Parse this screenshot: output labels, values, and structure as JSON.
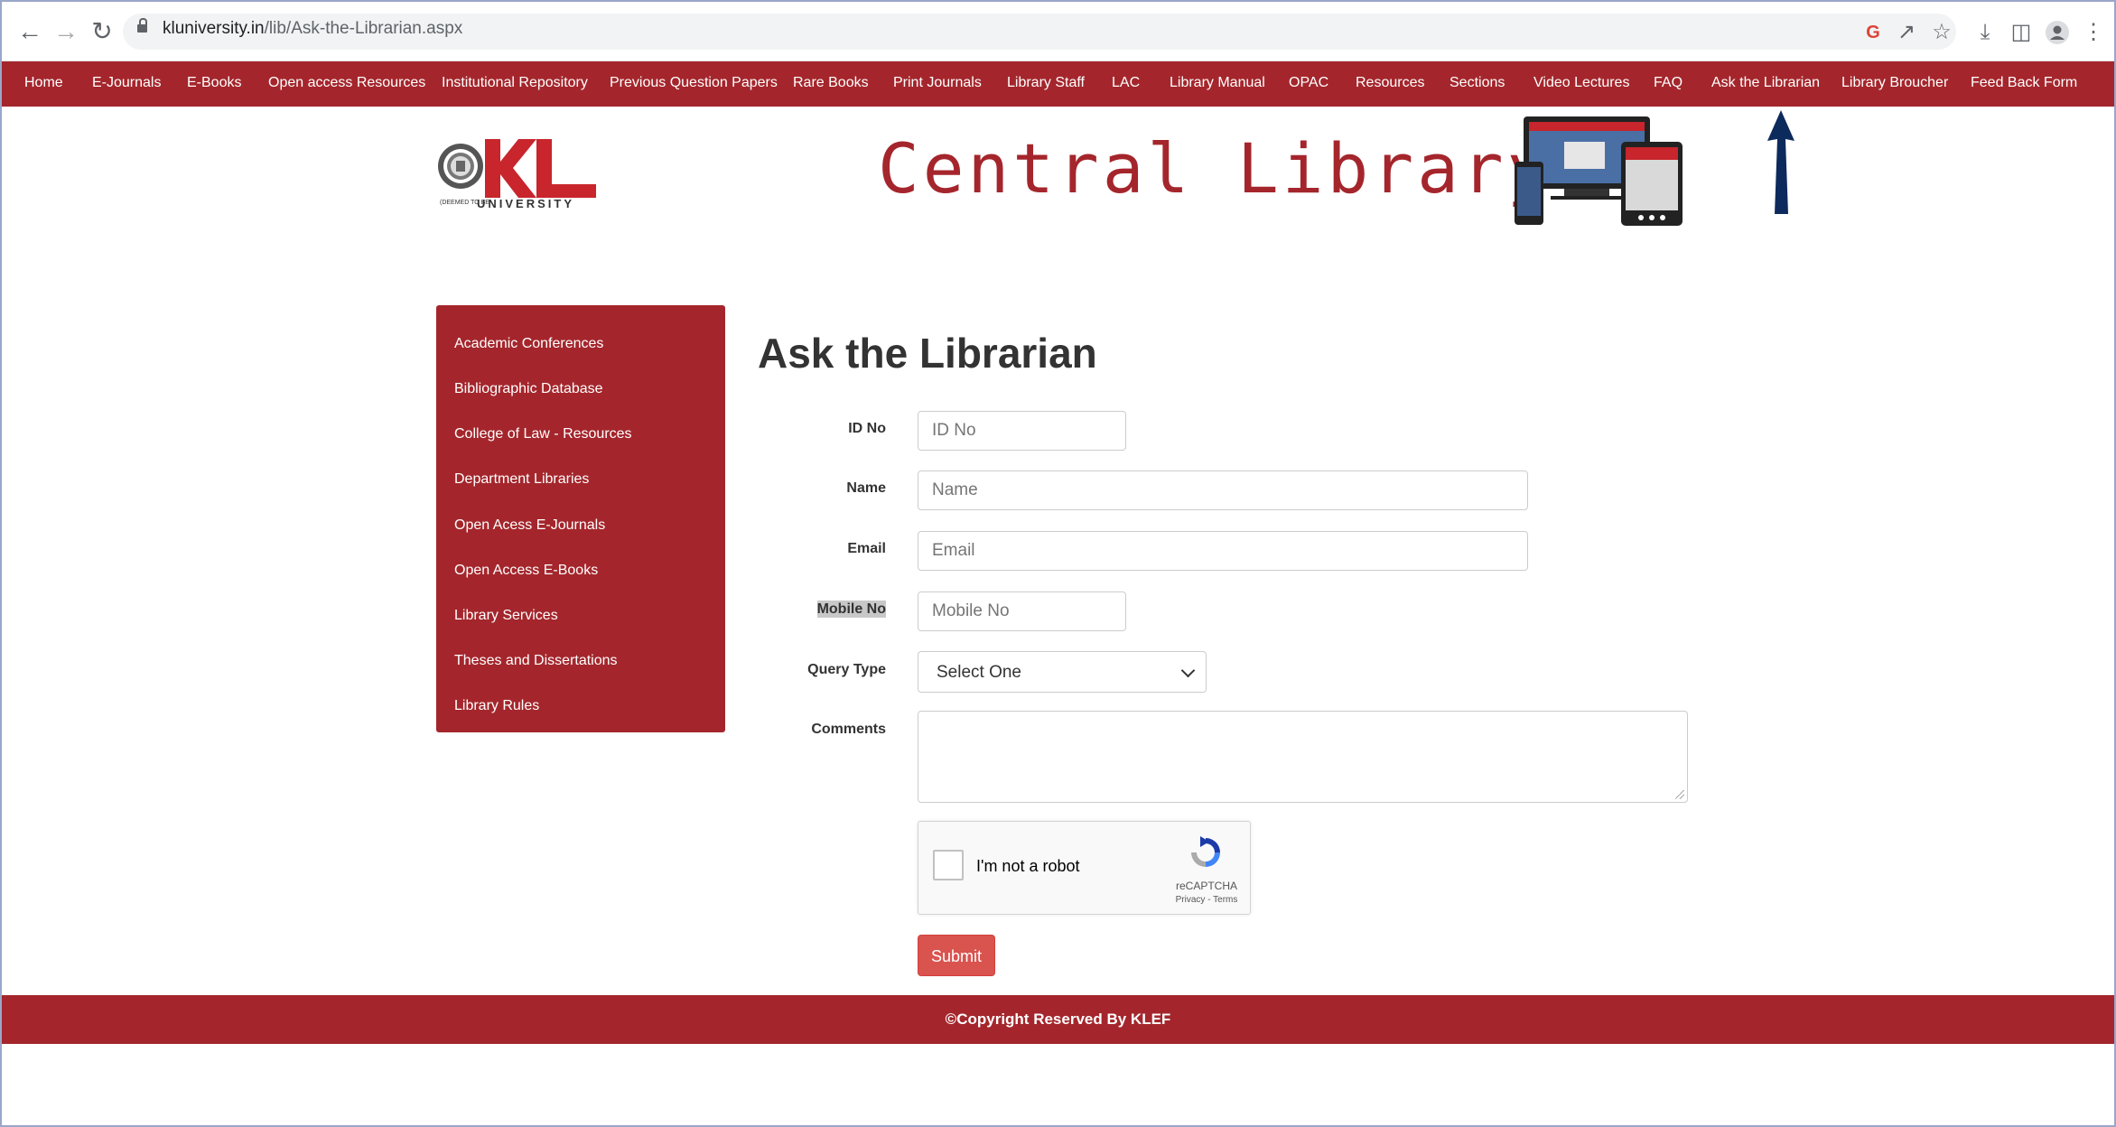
{
  "browser": {
    "url_domain": "kluniversity.in",
    "url_path": "/lib/Ask-the-Librarian.aspx"
  },
  "nav": {
    "items": [
      "Home",
      "E-Journals",
      "E-Books",
      "Open access Resources",
      "Institutional Repository",
      "Previous Question Papers",
      "Rare Books",
      "Print Journals",
      "Library Staff",
      "LAC",
      "Library Manual",
      "OPAC",
      "Resources",
      "Sections",
      "Video Lectures",
      "FAQ",
      "Ask the Librarian",
      "Library Broucher",
      "Feed Back Form"
    ]
  },
  "header": {
    "logo_text": "KL",
    "logo_sub": "UNIVERSITY",
    "logo_tag": "(DEEMED TO BE",
    "title": "Central Library"
  },
  "sidebar": {
    "items": [
      "Academic Conferences",
      "Bibliographic Database",
      "College of Law - Resources",
      "Department Libraries",
      "Open Acess E-Journals",
      "Open Access E-Books",
      "Library Services",
      "Theses and Dissertations",
      "Library Rules"
    ]
  },
  "form": {
    "title": "Ask the Librarian",
    "id_label": "ID No",
    "id_placeholder": "ID No",
    "name_label": "Name",
    "name_placeholder": "Name",
    "email_label": "Email",
    "email_placeholder": "Email",
    "mobile_label": "Mobile No",
    "mobile_placeholder": "Mobile No",
    "query_label": "Query Type",
    "query_selected": "Select One",
    "comments_label": "Comments",
    "captcha_text": "I'm not a robot",
    "captcha_brand": "reCAPTCHA",
    "captcha_terms": "Privacy - Terms",
    "submit_label": "Submit"
  },
  "footer": {
    "text": "©Copyright Reserved By KLEF"
  },
  "colors": {
    "brand_red": "#a4262c",
    "submit_red": "#d9534f",
    "arrow_navy": "#0d2a5c"
  }
}
